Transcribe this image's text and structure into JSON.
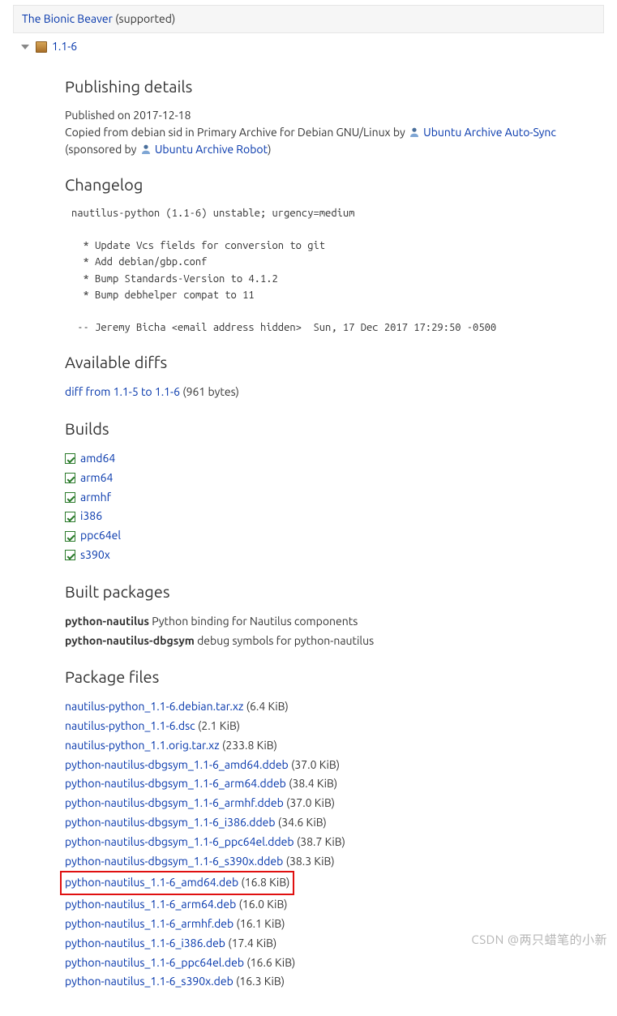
{
  "header": {
    "distro_link": "The Bionic Beaver",
    "distro_status": " (supported)"
  },
  "version_row": {
    "version_link": "1.1-6"
  },
  "publishing": {
    "heading": "Publishing details",
    "published": "Published on 2017-12-18",
    "copied_prefix": "Copied from debian sid in Primary Archive for Debian GNU/Linux by ",
    "auto_sync_link": "Ubuntu Archive Auto-Sync",
    "sponsored_prefix": " (sponsored by ",
    "robot_link": "Ubuntu Archive Robot",
    "sponsored_suffix": ")"
  },
  "changelog": {
    "heading": "Changelog",
    "text": "nautilus-python (1.1-6) unstable; urgency=medium\n\n  * Update Vcs fields for conversion to git\n  * Add debian/gbp.conf\n  * Bump Standards-Version to 4.1.2\n  * Bump debhelper compat to 11\n\n -- Jeremy Bicha <email address hidden>  Sun, 17 Dec 2017 17:29:50 -0500"
  },
  "diffs": {
    "heading": "Available diffs",
    "link": "diff from 1.1-5 to 1.1-6",
    "size": " (961 bytes)"
  },
  "builds": {
    "heading": "Builds",
    "items": [
      "amd64",
      "arm64",
      "armhf",
      "i386",
      "ppc64el",
      "s390x"
    ]
  },
  "built_packages": {
    "heading": "Built packages",
    "items": [
      {
        "name": "python-nautilus",
        "desc": " Python binding for Nautilus components"
      },
      {
        "name": "python-nautilus-dbgsym",
        "desc": " debug symbols for python-nautilus"
      }
    ]
  },
  "package_files": {
    "heading": "Package files",
    "items": [
      {
        "name": "nautilus-python_1.1-6.debian.tar.xz",
        "size": " (6.4 KiB)"
      },
      {
        "name": "nautilus-python_1.1-6.dsc",
        "size": " (2.1 KiB)"
      },
      {
        "name": "nautilus-python_1.1.orig.tar.xz",
        "size": " (233.8 KiB)"
      },
      {
        "name": "python-nautilus-dbgsym_1.1-6_amd64.ddeb",
        "size": " (37.0 KiB)"
      },
      {
        "name": "python-nautilus-dbgsym_1.1-6_arm64.ddeb",
        "size": " (38.4 KiB)"
      },
      {
        "name": "python-nautilus-dbgsym_1.1-6_armhf.ddeb",
        "size": " (37.0 KiB)"
      },
      {
        "name": "python-nautilus-dbgsym_1.1-6_i386.ddeb",
        "size": " (34.6 KiB)"
      },
      {
        "name": "python-nautilus-dbgsym_1.1-6_ppc64el.ddeb",
        "size": " (38.7 KiB)"
      },
      {
        "name": "python-nautilus-dbgsym_1.1-6_s390x.ddeb",
        "size": " (38.3 KiB)"
      },
      {
        "name": "python-nautilus_1.1-6_amd64.deb",
        "size": " (16.8 KiB)",
        "highlight": true
      },
      {
        "name": "python-nautilus_1.1-6_arm64.deb",
        "size": " (16.0 KiB)"
      },
      {
        "name": "python-nautilus_1.1-6_armhf.deb",
        "size": " (16.1 KiB)"
      },
      {
        "name": "python-nautilus_1.1-6_i386.deb",
        "size": " (17.4 KiB)"
      },
      {
        "name": "python-nautilus_1.1-6_ppc64el.deb",
        "size": " (16.6 KiB)"
      },
      {
        "name": "python-nautilus_1.1-6_s390x.deb",
        "size": " (16.3 KiB)"
      }
    ]
  },
  "watermark": "CSDN @两只蜡笔的小新"
}
